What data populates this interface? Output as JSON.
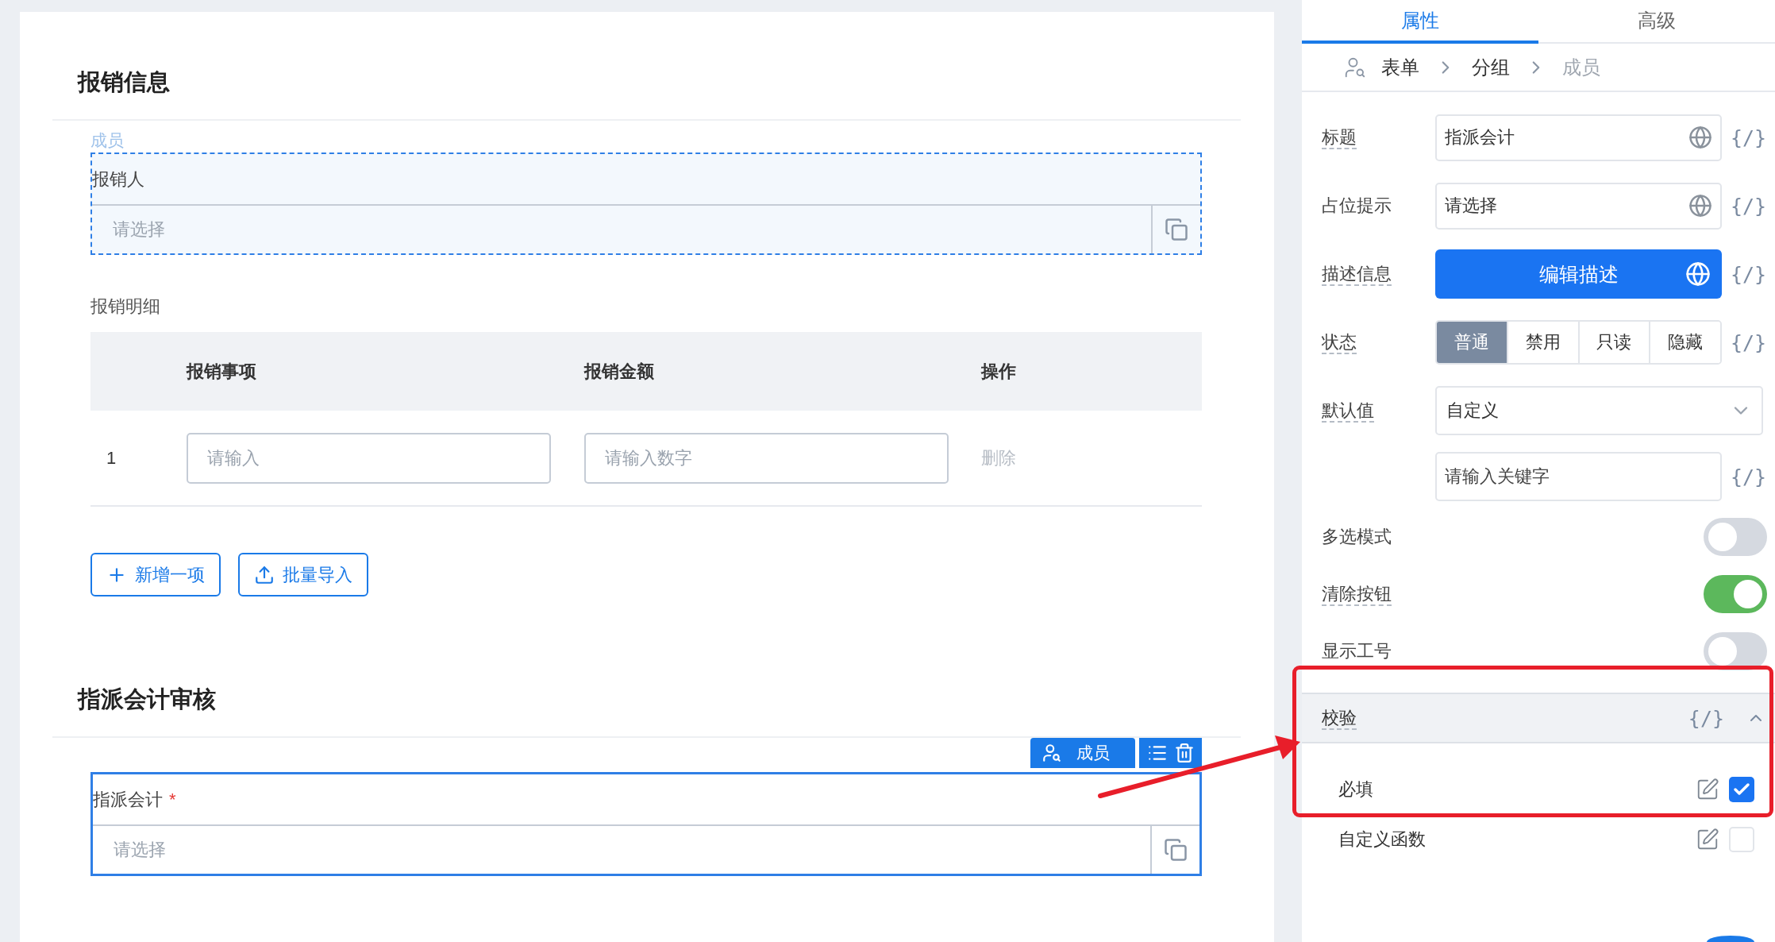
{
  "form": {
    "sections": [
      {
        "title": "报销信息",
        "items": [
          {
            "kind": "member",
            "tag": "成员",
            "label": "报销人",
            "placeholder": "请选择",
            "hovered": true,
            "selected": false
          },
          {
            "kind": "table",
            "label": "报销明细",
            "columns": [
              "报销事项",
              "报销金额",
              "操作"
            ],
            "rows": [
              {
                "index": "1",
                "item_placeholder": "请输入",
                "amount_placeholder": "请输入数字",
                "action": "删除"
              }
            ],
            "buttons": [
              "新增一项",
              "批量导入"
            ]
          }
        ]
      },
      {
        "title": "指派会计审核",
        "items": [
          {
            "kind": "member",
            "toolbar_label": "成员",
            "label": "指派会计",
            "required_mark": "*",
            "placeholder": "请选择",
            "hovered": false,
            "selected": true
          }
        ]
      }
    ]
  },
  "panel": {
    "tabs": [
      {
        "label": "属性",
        "selected": true
      },
      {
        "label": "高级",
        "selected": false
      }
    ],
    "breadcrumb": [
      {
        "label": "表单",
        "current": false
      },
      {
        "label": "分组",
        "current": false
      },
      {
        "label": "成员",
        "current": true
      }
    ],
    "props": [
      {
        "kind": "input",
        "label": "标题",
        "tip": true,
        "value": "指派会计",
        "code": "{/}"
      },
      {
        "kind": "input",
        "label": "占位提示",
        "tip": false,
        "value": "请选择",
        "code": "{/}"
      },
      {
        "kind": "button",
        "label": "描述信息",
        "tip": true,
        "value": "编辑描述",
        "code": "{/}"
      },
      {
        "kind": "segments",
        "label": "状态",
        "tip": true,
        "options": [
          {
            "label": "普通",
            "selected": true
          },
          {
            "label": "禁用",
            "selected": false
          },
          {
            "label": "只读",
            "selected": false
          },
          {
            "label": "隐藏",
            "selected": false
          }
        ],
        "code": "{/}"
      },
      {
        "kind": "select",
        "label": "默认值",
        "tip": true,
        "value": "自定义"
      },
      {
        "kind": "search",
        "placeholder": "请输入关键字",
        "code": "{/}"
      },
      {
        "kind": "switch",
        "label": "多选模式",
        "tip": false,
        "on": false
      },
      {
        "kind": "switch",
        "label": "清除按钮",
        "tip": true,
        "on": true
      },
      {
        "kind": "switch",
        "label": "显示工号",
        "tip": false,
        "on": false
      }
    ],
    "validation": {
      "title": "校验",
      "tip": true,
      "code": "{/}",
      "expanded": true,
      "rules": [
        {
          "label": "必填",
          "checked": true
        },
        {
          "label": "自定义函数",
          "checked": false
        }
      ]
    }
  }
}
